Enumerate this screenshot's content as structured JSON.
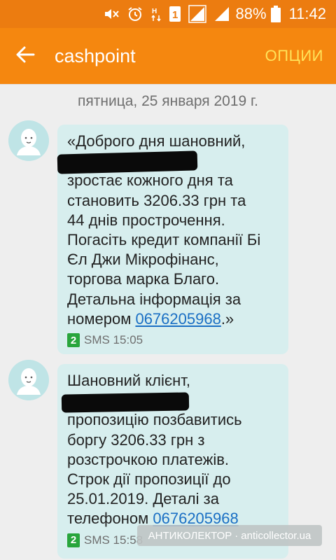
{
  "status_bar": {
    "battery_text": "88%",
    "time": "11:42",
    "sim_label": "1",
    "icons": [
      "mute-icon",
      "alarm-icon",
      "network-icon",
      "sim-icon",
      "signal-icon",
      "signal-icon",
      "battery-icon"
    ]
  },
  "app_bar": {
    "title": "cashpoint",
    "options_label": "ОПЦИИ",
    "back_icon": "back-arrow-icon"
  },
  "conversation": {
    "date": "пятница, 25 января 2019 г.",
    "messages": [
      {
        "text_before": "«Доброго дня шановний,\n                         Ваш БОРГ\nзростає кожного дня та\nстановить 3206.33 грн та\n44 днів прострочення.\nПогасіть кредит компанії Бі\nЄл Джи Мікрофінанс,\nторгова марка Благо.\nДетальна інформація за\nномером ",
        "phone": "0676205968",
        "text_after": ".»",
        "sim": "2",
        "meta": "SMS 15:05"
      },
      {
        "text_before": "Шановний клієнт,\n                        маємо\nпропозицію позбавитись\nборгу 3206.33  грн з\nрозстрочкою платежів.\nСтрок дії пропозиції до\n25.01.2019. Деталі за\nтелефоном ",
        "phone": "0676205968",
        "text_after": "",
        "sim": "2",
        "meta": "SMS 15:58"
      }
    ]
  },
  "watermark": {
    "left": "АНТИКОЛЕКТОР",
    "separator": "·",
    "right": "anticollector.ua"
  },
  "colors": {
    "status_bar": "#ec7c10",
    "app_bar": "#f5870f",
    "options": "#ffe35a",
    "bubble": "#d7eeee",
    "link": "#1a6fc4",
    "sim_badge": "#28a53c"
  }
}
